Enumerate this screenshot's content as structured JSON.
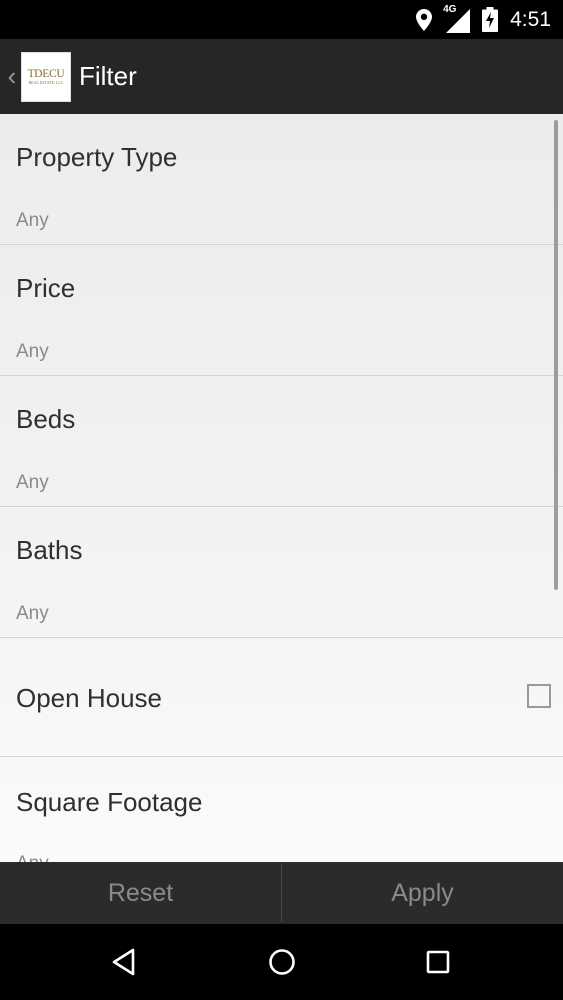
{
  "status_bar": {
    "network_label": "4G",
    "time": "4:51"
  },
  "app_bar": {
    "back_glyph": "‹",
    "logo": {
      "main": "TDECU",
      "sub": "REAL ESTATE, LLC"
    },
    "title": "Filter"
  },
  "filters": [
    {
      "title": "Property Type",
      "value": "Any"
    },
    {
      "title": "Price",
      "value": "Any"
    },
    {
      "title": "Beds",
      "value": "Any"
    },
    {
      "title": "Baths",
      "value": "Any"
    }
  ],
  "open_house": {
    "title": "Open House",
    "checked": false
  },
  "square_footage": {
    "title": "Square Footage",
    "value": "Any"
  },
  "buttons": {
    "reset": "Reset",
    "apply": "Apply"
  },
  "icons": {
    "location": "location-pin-icon",
    "signal": "cell-signal-icon",
    "battery": "battery-charging-icon",
    "back": "nav-back-icon",
    "home": "nav-home-icon",
    "recents": "nav-recents-icon"
  }
}
